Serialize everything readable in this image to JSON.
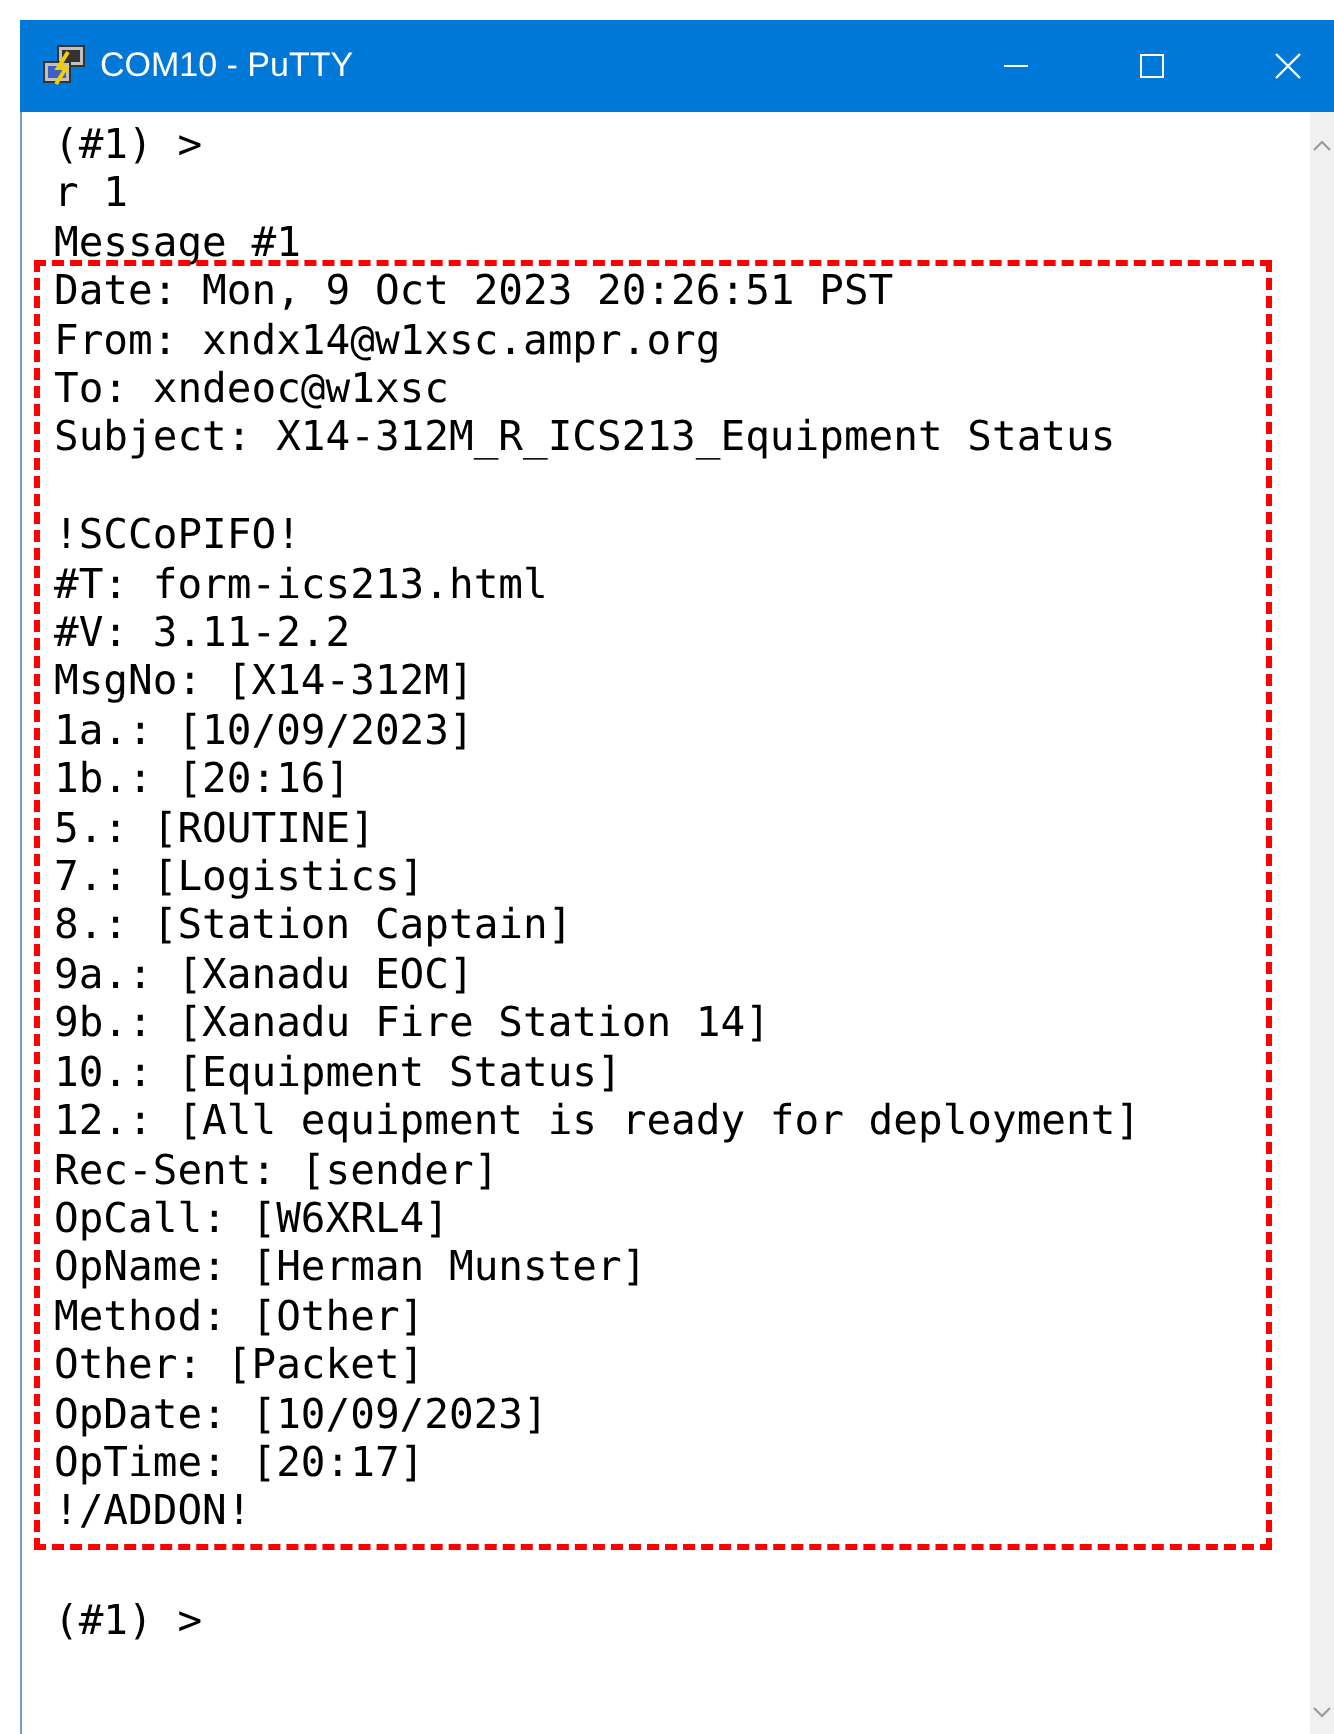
{
  "window": {
    "title": "COM10 - PuTTY"
  },
  "terminal": {
    "lines_before": [
      "(#1) >",
      "r 1",
      "Message #1"
    ],
    "highlighted": {
      "header": [
        "Date: Mon, 9 Oct 2023 20:26:51 PST",
        "From: xndx14@w1xsc.ampr.org",
        "To: xndeoc@w1xsc",
        "Subject: X14-312M_R_ICS213_Equipment Status"
      ],
      "body": [
        "!SCCoPIFO!",
        "#T: form-ics213.html",
        "#V: 3.11-2.2",
        "MsgNo: [X14-312M]",
        "1a.: [10/09/2023]",
        "1b.: [20:16]",
        "5.: [ROUTINE]",
        "7.: [Logistics]",
        "8.: [Station Captain]",
        "9a.: [Xanadu EOC]",
        "9b.: [Xanadu Fire Station 14]",
        "10.: [Equipment Status]",
        "12.: [All equipment is ready for deployment]",
        "Rec-Sent: [sender]",
        "OpCall: [W6XRL4]",
        "OpName: [Herman Munster]",
        "Method: [Other]",
        "Other: [Packet]",
        "OpDate: [10/09/2023]",
        "OpTime: [20:17]",
        "!/ADDON!"
      ]
    },
    "lines_after": [
      "(#1) >"
    ]
  }
}
